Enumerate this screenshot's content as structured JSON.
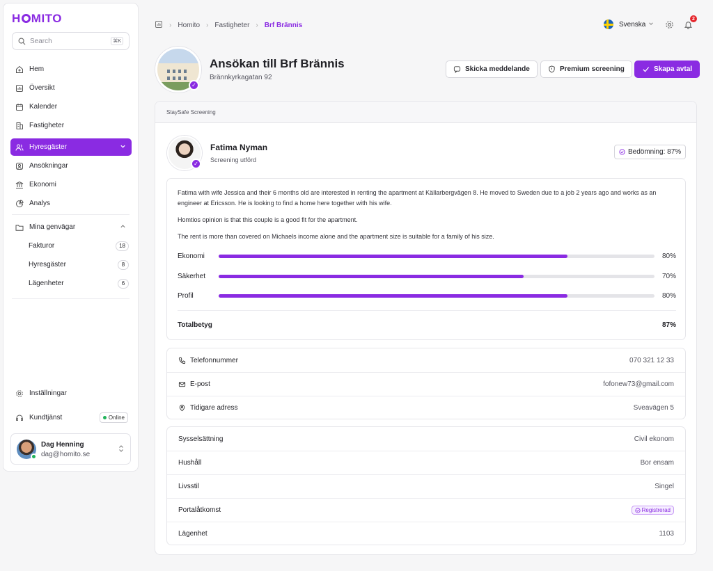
{
  "app": {
    "logo": "HOMITO"
  },
  "search": {
    "placeholder": "Search",
    "shortcut": "⌘K"
  },
  "sidebar": {
    "nav": [
      {
        "label": "Hem",
        "icon": "home-icon"
      },
      {
        "label": "Översikt",
        "icon": "chart-icon"
      },
      {
        "label": "Kalender",
        "icon": "calendar-icon"
      },
      {
        "label": "Fastigheter",
        "icon": "building-icon"
      },
      {
        "label": "Hyresgäster",
        "icon": "users-icon",
        "active": true
      },
      {
        "label": "Ansökningar",
        "icon": "user-square-icon"
      },
      {
        "label": "Ekonomi",
        "icon": "bank-icon"
      },
      {
        "label": "Analys",
        "icon": "pie-chart-icon"
      }
    ],
    "shortcuts": {
      "label": "Mina genvägar",
      "items": [
        {
          "label": "Fakturor",
          "count": "18"
        },
        {
          "label": "Hyresgäster",
          "count": "8"
        },
        {
          "label": "Lägenheter",
          "count": "6"
        }
      ]
    },
    "settings_label": "Inställningar",
    "support_label": "Kundtjänst",
    "online_label": "Online",
    "user": {
      "name": "Dag Henning",
      "email": "dag@homito.se"
    }
  },
  "breadcrumb": [
    "Homito",
    "Fastigheter",
    "Brf Brännis"
  ],
  "header": {
    "language": "Svenska",
    "notifications": "2",
    "title": "Ansökan till Brf Brännis",
    "address": "Brännkyrkagatan 92",
    "buttons": {
      "message": "Skicka meddelande",
      "premium": "Premium screening",
      "create": "Skapa avtal"
    }
  },
  "screening": {
    "section_title": "StaySafe Screening",
    "applicant": {
      "name": "Fatima Nyman",
      "status": "Screening utförd"
    },
    "rating_label": "Bedömning: 87%",
    "description": [
      "Fatima with wife Jessica and their 6 months old are interested in renting the apartment at Källarbergvägen 8. He moved to Sweden due to a job 2 years ago and works as an engineer at Ericsson. He is looking to find a home here together with his wife.",
      "Homtios opinion is that this couple is a good fit for the apartment.",
      "The rent is more than covered on Michaels income alone and the apartment size is suitable for a family of his size."
    ],
    "scores": [
      {
        "label": "Ekonomi",
        "value": 80,
        "display": "80%"
      },
      {
        "label": "Säkerhet",
        "value": 70,
        "display": "70%"
      },
      {
        "label": "Profil",
        "value": 80,
        "display": "80%"
      }
    ],
    "total": {
      "label": "Totalbetyg",
      "value": "87%"
    },
    "contact": [
      {
        "label": "Telefonnummer",
        "value": "070 321 12 33",
        "icon": "phone-icon"
      },
      {
        "label": "E-post",
        "value": "fofonew73@gmail.com",
        "icon": "mail-icon"
      },
      {
        "label": "Tidigare adress",
        "value": "Sveavägen 5",
        "icon": "location-icon"
      }
    ],
    "details": [
      {
        "label": "Sysselsättning",
        "value": "Civil ekonom"
      },
      {
        "label": "Hushåll",
        "value": "Bor ensam"
      },
      {
        "label": "Livsstil",
        "value": "Singel"
      },
      {
        "label": "Portalåtkomst",
        "value": "Registrerad",
        "badge": true
      },
      {
        "label": "Lägenhet",
        "value": "1103"
      }
    ]
  },
  "colors": {
    "accent": "#8a2be2",
    "online": "#21b35a",
    "badge": "#e5252b"
  }
}
